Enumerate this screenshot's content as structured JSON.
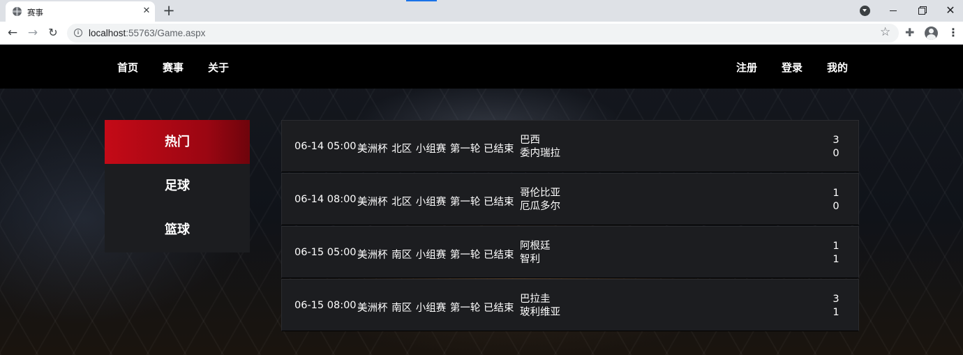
{
  "browser": {
    "tab_title": "赛事",
    "new_tab": "+",
    "url_host": "localhost",
    "url_path": ":55763/Game.aspx"
  },
  "nav": {
    "left": [
      "首页",
      "赛事",
      "关于"
    ],
    "right": [
      "注册",
      "登录",
      "我的"
    ]
  },
  "sidebar": {
    "items": [
      {
        "label": "热门",
        "active": true
      },
      {
        "label": "足球",
        "active": false
      },
      {
        "label": "篮球",
        "active": false
      }
    ]
  },
  "matches": [
    {
      "time": "06-14 05:00",
      "league": "美洲杯 北区 小组赛 第一轮",
      "status": "已结束",
      "home": "巴西",
      "away": "委内瑞拉",
      "home_score": "3",
      "away_score": "0"
    },
    {
      "time": "06-14 08:00",
      "league": "美洲杯 北区 小组赛 第一轮",
      "status": "已结束",
      "home": "哥伦比亚",
      "away": "厄瓜多尔",
      "home_score": "1",
      "away_score": "0"
    },
    {
      "time": "06-15 05:00",
      "league": "美洲杯 南区 小组赛 第一轮",
      "status": "已结束",
      "home": "阿根廷",
      "away": "智利",
      "home_score": "1",
      "away_score": "1"
    },
    {
      "time": "06-15 08:00",
      "league": "美洲杯 南区 小组赛 第一轮",
      "status": "已结束",
      "home": "巴拉圭",
      "away": "玻利维亚",
      "home_score": "3",
      "away_score": "1"
    }
  ],
  "colors": {
    "accent": "#c40a17",
    "nav_bg": "#000000",
    "panel_bg": "#1c1d20"
  }
}
